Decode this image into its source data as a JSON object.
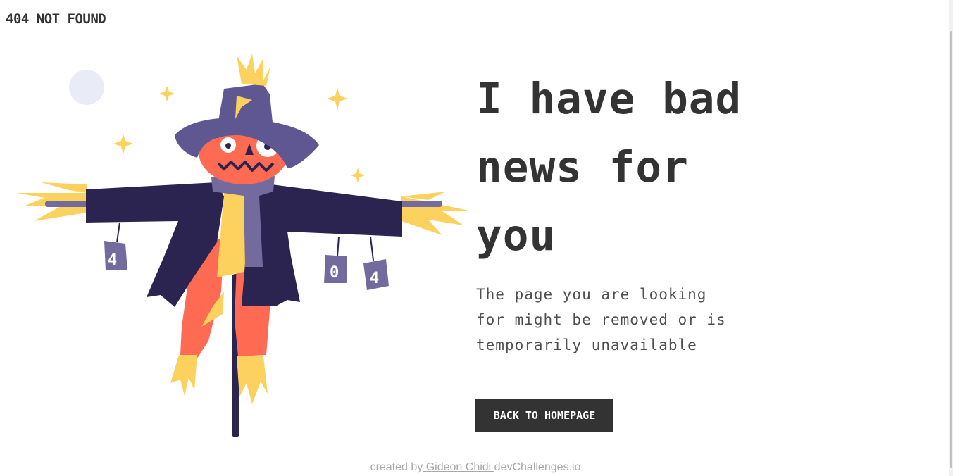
{
  "header": {
    "title": "404 NOT FOUND"
  },
  "main": {
    "headline": "I have bad news for you",
    "description": "The page you are looking for might be removed or is temporarily unavailable",
    "button_label": "BACK TO HOMEPAGE"
  },
  "illustration": {
    "can_labels": [
      "4",
      "0",
      "4"
    ],
    "colors": {
      "hat": "#5f5792",
      "coat": "#2b2450",
      "pumpkin": "#ff6a52",
      "straw": "#fdd15d",
      "scarf": "#736a9e",
      "moon": "#e9ecf6"
    }
  },
  "footer": {
    "prefix": "created by",
    "author": " Gideon Chidi ",
    "site": "devChallenges.io"
  }
}
